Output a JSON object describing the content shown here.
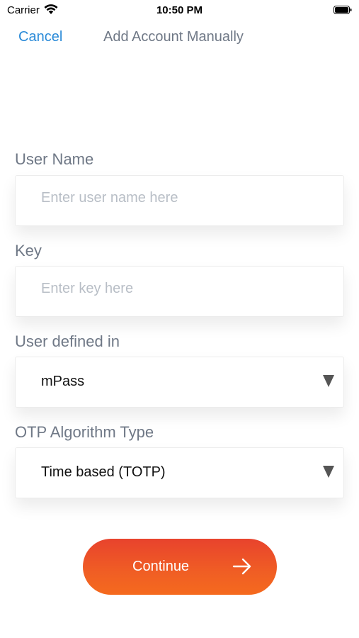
{
  "status_bar": {
    "carrier": "Carrier",
    "time": "10:50 PM"
  },
  "nav": {
    "cancel_label": "Cancel",
    "title": "Add Account Manually"
  },
  "form": {
    "user_name": {
      "label": "User Name",
      "placeholder": "Enter user name here",
      "value": ""
    },
    "key": {
      "label": "Key",
      "placeholder": "Enter key here",
      "value": ""
    },
    "user_defined_in": {
      "label": "User defined in",
      "selected": "mPass"
    },
    "otp_algorithm_type": {
      "label": "OTP Algorithm Type",
      "selected": "Time based (TOTP)"
    }
  },
  "continue_button": {
    "label": "Continue",
    "icon": "arrow-right-icon"
  },
  "colors": {
    "accent_link": "#2a8ad8",
    "label_gray": "#6f7886",
    "placeholder_gray": "#b8bec6",
    "button_gradient_start": "#e8432d",
    "button_gradient_end": "#f56a1e"
  }
}
